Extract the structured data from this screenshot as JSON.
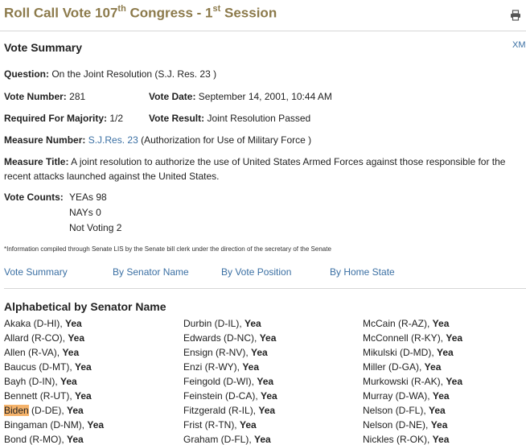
{
  "header": {
    "title_part1": "Roll Call Vote 107",
    "title_sup1": "th",
    "title_part2": " Congress - 1",
    "title_sup2": "st",
    "title_part3": " Session",
    "xml_link": "XM"
  },
  "summary": {
    "heading": "Vote Summary",
    "question_label": "Question:",
    "question_value": "On the Joint Resolution (S.J. Res. 23 )",
    "vote_number_label": "Vote Number:",
    "vote_number_value": "281",
    "vote_date_label": "Vote Date:",
    "vote_date_value": "September 14, 2001, 10:44 AM",
    "majority_label": "Required For Majority:",
    "majority_value": "1/2",
    "result_label": "Vote Result:",
    "result_value": "Joint Resolution Passed",
    "measure_number_label": "Measure Number:",
    "measure_number_link": "S.J.Res. 23",
    "measure_number_rest": "(Authorization for Use of Military Force )",
    "measure_title_label": "Measure Title:",
    "measure_title_value": "A joint resolution to authorize the use of United States Armed Forces against those responsible for the recent attacks launched against the United States.",
    "counts_label": "Vote Counts:",
    "yeas": "YEAs  98",
    "nays": "NAYs  0",
    "not_voting": "Not Voting  2",
    "footnote": "*Information compiled through Senate LIS by the Senate bill clerk under the direction of the secretary of the Senate"
  },
  "nav": [
    "Vote Summary",
    "By Senator Name",
    "By Vote Position",
    "By Home State"
  ],
  "alpha": {
    "heading": "Alphabetical by Senator Name",
    "columns": [
      [
        {
          "name": "Akaka (D-HI),",
          "vote": "Yea"
        },
        {
          "name": "Allard (R-CO),",
          "vote": "Yea"
        },
        {
          "name": "Allen (R-VA),",
          "vote": "Yea"
        },
        {
          "name": "Baucus (D-MT),",
          "vote": "Yea"
        },
        {
          "name": "Bayh (D-IN),",
          "vote": "Yea"
        },
        {
          "name": "Bennett (R-UT),",
          "vote": "Yea"
        },
        {
          "name_hl": "Biden",
          "name": " (D-DE),",
          "vote": "Yea"
        },
        {
          "name": "Bingaman (D-NM),",
          "vote": "Yea"
        },
        {
          "name": "Bond (R-MO),",
          "vote": "Yea"
        }
      ],
      [
        {
          "name": "Durbin (D-IL),",
          "vote": "Yea"
        },
        {
          "name": "Edwards (D-NC),",
          "vote": "Yea"
        },
        {
          "name": "Ensign (R-NV),",
          "vote": "Yea"
        },
        {
          "name": "Enzi (R-WY),",
          "vote": "Yea"
        },
        {
          "name": "Feingold (D-WI),",
          "vote": "Yea"
        },
        {
          "name": "Feinstein (D-CA),",
          "vote": "Yea"
        },
        {
          "name": "Fitzgerald (R-IL),",
          "vote": "Yea"
        },
        {
          "name": "Frist (R-TN),",
          "vote": "Yea"
        },
        {
          "name": "Graham (D-FL),",
          "vote": "Yea"
        }
      ],
      [
        {
          "name": "McCain (R-AZ),",
          "vote": "Yea"
        },
        {
          "name": "McConnell (R-KY),",
          "vote": "Yea"
        },
        {
          "name": "Mikulski (D-MD),",
          "vote": "Yea"
        },
        {
          "name": "Miller (D-GA),",
          "vote": "Yea"
        },
        {
          "name": "Murkowski (R-AK),",
          "vote": "Yea"
        },
        {
          "name": "Murray (D-WA),",
          "vote": "Yea"
        },
        {
          "name": "Nelson (D-FL),",
          "vote": "Yea"
        },
        {
          "name": "Nelson (D-NE),",
          "vote": "Yea"
        },
        {
          "name": "Nickles (R-OK),",
          "vote": "Yea"
        }
      ]
    ]
  },
  "colors": {
    "title": "#8c7a4b",
    "link": "#3a6fa3",
    "highlight": "#f5b36b"
  },
  "icons": {
    "print": "printer-icon"
  }
}
